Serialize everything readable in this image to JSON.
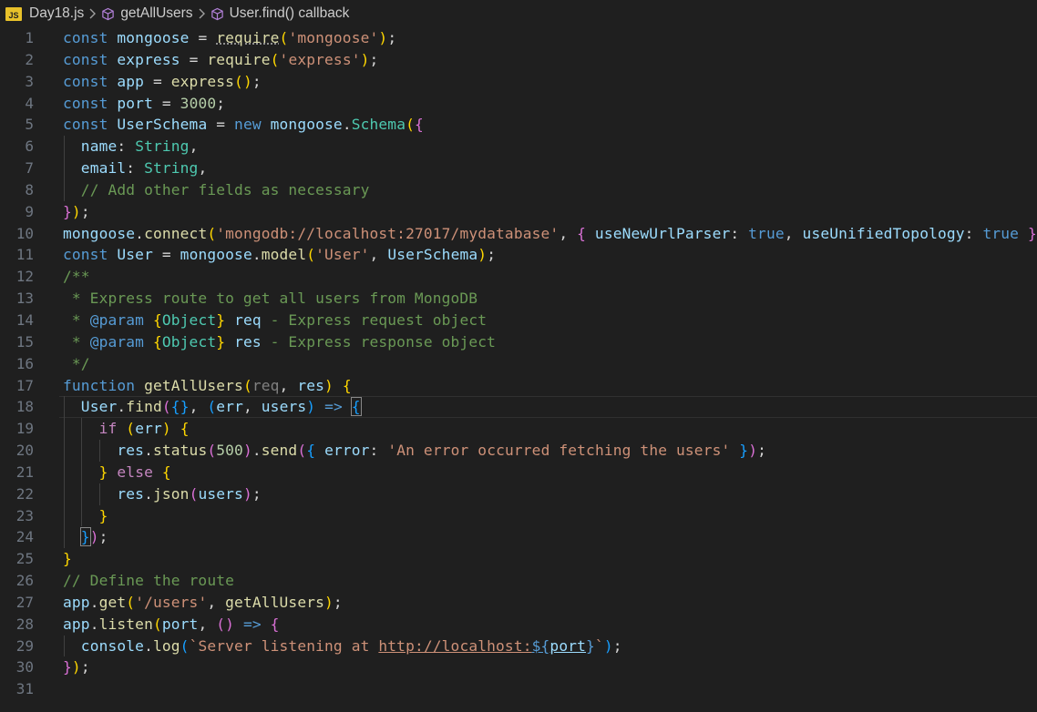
{
  "breadcrumb": {
    "file_icon": "JS",
    "file": "Day18.js",
    "symbol1": "getAllUsers",
    "symbol2": "User.find() callback"
  },
  "editor": {
    "language": "javascript",
    "current_line": 18,
    "lines": [
      {
        "n": "1",
        "t": [
          [
            "kw",
            "const"
          ],
          [
            "pln",
            " "
          ],
          [
            "var",
            "mongoose"
          ],
          [
            "pln",
            " = "
          ],
          [
            "fn dots",
            "require"
          ],
          [
            "b1",
            "("
          ],
          [
            "str",
            "'mongoose'"
          ],
          [
            "b1",
            ")"
          ],
          [
            "pln",
            ";"
          ]
        ]
      },
      {
        "n": "2",
        "t": [
          [
            "kw",
            "const"
          ],
          [
            "pln",
            " "
          ],
          [
            "var",
            "express"
          ],
          [
            "pln",
            " = "
          ],
          [
            "fn",
            "require"
          ],
          [
            "b1",
            "("
          ],
          [
            "str",
            "'express'"
          ],
          [
            "b1",
            ")"
          ],
          [
            "pln",
            ";"
          ]
        ]
      },
      {
        "n": "3",
        "t": [
          [
            "kw",
            "const"
          ],
          [
            "pln",
            " "
          ],
          [
            "var",
            "app"
          ],
          [
            "pln",
            " = "
          ],
          [
            "fn",
            "express"
          ],
          [
            "b1",
            "()"
          ],
          [
            "pln",
            ";"
          ]
        ]
      },
      {
        "n": "4",
        "t": [
          [
            "kw",
            "const"
          ],
          [
            "pln",
            " "
          ],
          [
            "var",
            "port"
          ],
          [
            "pln",
            " = "
          ],
          [
            "num",
            "3000"
          ],
          [
            "pln",
            ";"
          ]
        ]
      },
      {
        "n": "5",
        "t": [
          [
            "kw",
            "const"
          ],
          [
            "pln",
            " "
          ],
          [
            "var",
            "UserSchema"
          ],
          [
            "pln",
            " = "
          ],
          [
            "kw",
            "new"
          ],
          [
            "pln",
            " "
          ],
          [
            "var",
            "mongoose"
          ],
          [
            "pln",
            "."
          ],
          [
            "cls",
            "Schema"
          ],
          [
            "b1",
            "("
          ],
          [
            "b2",
            "{"
          ]
        ]
      },
      {
        "n": "6",
        "t": [
          [
            "pln",
            "  "
          ],
          [
            "var",
            "name"
          ],
          [
            "pln",
            ": "
          ],
          [
            "cls",
            "String"
          ],
          [
            "pln",
            ","
          ]
        ]
      },
      {
        "n": "7",
        "t": [
          [
            "pln",
            "  "
          ],
          [
            "var",
            "email"
          ],
          [
            "pln",
            ": "
          ],
          [
            "cls",
            "String"
          ],
          [
            "pln",
            ","
          ]
        ]
      },
      {
        "n": "8",
        "t": [
          [
            "pln",
            "  "
          ],
          [
            "com",
            "// Add other fields as necessary"
          ]
        ]
      },
      {
        "n": "9",
        "t": [
          [
            "b2",
            "}"
          ],
          [
            "b1",
            ")"
          ],
          [
            "pln",
            ";"
          ]
        ]
      },
      {
        "n": "10",
        "t": [
          [
            "var",
            "mongoose"
          ],
          [
            "pln",
            "."
          ],
          [
            "fn",
            "connect"
          ],
          [
            "b1",
            "("
          ],
          [
            "str",
            "'mongodb://localhost:27017/mydatabase'"
          ],
          [
            "pln",
            ", "
          ],
          [
            "b2",
            "{"
          ],
          [
            "pln",
            " "
          ],
          [
            "var",
            "useNewUrlParser"
          ],
          [
            "pln",
            ": "
          ],
          [
            "kw",
            "true"
          ],
          [
            "pln",
            ", "
          ],
          [
            "var",
            "useUnifiedTopology"
          ],
          [
            "pln",
            ": "
          ],
          [
            "kw",
            "true"
          ],
          [
            "pln",
            " "
          ],
          [
            "b2",
            "}"
          ],
          [
            "b1",
            ")"
          ],
          [
            "pln",
            ";"
          ]
        ]
      },
      {
        "n": "11",
        "t": [
          [
            "kw",
            "const"
          ],
          [
            "pln",
            " "
          ],
          [
            "var",
            "User"
          ],
          [
            "pln",
            " = "
          ],
          [
            "var",
            "mongoose"
          ],
          [
            "pln",
            "."
          ],
          [
            "fn",
            "model"
          ],
          [
            "b1",
            "("
          ],
          [
            "str",
            "'User'"
          ],
          [
            "pln",
            ", "
          ],
          [
            "var",
            "UserSchema"
          ],
          [
            "b1",
            ")"
          ],
          [
            "pln",
            ";"
          ]
        ]
      },
      {
        "n": "12",
        "t": [
          [
            "com",
            "/**"
          ]
        ]
      },
      {
        "n": "13",
        "t": [
          [
            "com",
            " * Express route to get all users from MongoDB"
          ]
        ]
      },
      {
        "n": "14",
        "t": [
          [
            "com",
            " * "
          ],
          [
            "kw",
            "@param"
          ],
          [
            "com",
            " "
          ],
          [
            "b1",
            "{"
          ],
          [
            "cls",
            "Object"
          ],
          [
            "b1",
            "}"
          ],
          [
            "com",
            " "
          ],
          [
            "var",
            "req"
          ],
          [
            "com",
            " - Express request object"
          ]
        ]
      },
      {
        "n": "15",
        "t": [
          [
            "com",
            " * "
          ],
          [
            "kw",
            "@param"
          ],
          [
            "com",
            " "
          ],
          [
            "b1",
            "{"
          ],
          [
            "cls",
            "Object"
          ],
          [
            "b1",
            "}"
          ],
          [
            "com",
            " "
          ],
          [
            "var",
            "res"
          ],
          [
            "com",
            " - Express response object"
          ]
        ]
      },
      {
        "n": "16",
        "t": [
          [
            "com",
            " */"
          ]
        ]
      },
      {
        "n": "17",
        "t": [
          [
            "kw",
            "function"
          ],
          [
            "pln",
            " "
          ],
          [
            "fn",
            "getAllUsers"
          ],
          [
            "b1",
            "("
          ],
          [
            "dim",
            "req"
          ],
          [
            "pln",
            ", "
          ],
          [
            "var",
            "res"
          ],
          [
            "b1",
            ")"
          ],
          [
            "pln",
            " "
          ],
          [
            "b1",
            "{"
          ]
        ]
      },
      {
        "n": "18",
        "t": [
          [
            "pln",
            "  "
          ],
          [
            "var",
            "User"
          ],
          [
            "pln",
            "."
          ],
          [
            "fn",
            "find"
          ],
          [
            "b2",
            "("
          ],
          [
            "b3",
            "{}"
          ],
          [
            "pln",
            ", "
          ],
          [
            "b3",
            "("
          ],
          [
            "var",
            "err"
          ],
          [
            "pln",
            ", "
          ],
          [
            "var",
            "users"
          ],
          [
            "b3",
            ")"
          ],
          [
            "pln",
            " "
          ],
          [
            "kw",
            "=>"
          ],
          [
            "pln",
            " "
          ],
          [
            "b3 bm",
            "{"
          ]
        ]
      },
      {
        "n": "19",
        "t": [
          [
            "pln",
            "    "
          ],
          [
            "ctl",
            "if"
          ],
          [
            "pln",
            " "
          ],
          [
            "b1",
            "("
          ],
          [
            "var",
            "err"
          ],
          [
            "b1",
            ")"
          ],
          [
            "pln",
            " "
          ],
          [
            "b1",
            "{"
          ]
        ]
      },
      {
        "n": "20",
        "t": [
          [
            "pln",
            "      "
          ],
          [
            "var",
            "res"
          ],
          [
            "pln",
            "."
          ],
          [
            "fn",
            "status"
          ],
          [
            "b2",
            "("
          ],
          [
            "num",
            "500"
          ],
          [
            "b2",
            ")"
          ],
          [
            "pln",
            "."
          ],
          [
            "fn",
            "send"
          ],
          [
            "b2",
            "("
          ],
          [
            "b3",
            "{"
          ],
          [
            "pln",
            " "
          ],
          [
            "var",
            "error"
          ],
          [
            "pln",
            ": "
          ],
          [
            "str",
            "'An error occurred fetching the users'"
          ],
          [
            "pln",
            " "
          ],
          [
            "b3",
            "}"
          ],
          [
            "b2",
            ")"
          ],
          [
            "pln",
            ";"
          ]
        ]
      },
      {
        "n": "21",
        "t": [
          [
            "pln",
            "    "
          ],
          [
            "b1",
            "}"
          ],
          [
            "pln",
            " "
          ],
          [
            "ctl",
            "else"
          ],
          [
            "pln",
            " "
          ],
          [
            "b1",
            "{"
          ]
        ]
      },
      {
        "n": "22",
        "t": [
          [
            "pln",
            "      "
          ],
          [
            "var",
            "res"
          ],
          [
            "pln",
            "."
          ],
          [
            "fn",
            "json"
          ],
          [
            "b2",
            "("
          ],
          [
            "var",
            "users"
          ],
          [
            "b2",
            ")"
          ],
          [
            "pln",
            ";"
          ]
        ]
      },
      {
        "n": "23",
        "t": [
          [
            "pln",
            "    "
          ],
          [
            "b1",
            "}"
          ]
        ]
      },
      {
        "n": "24",
        "t": [
          [
            "pln",
            "  "
          ],
          [
            "b3 bm",
            "}"
          ],
          [
            "b2",
            ")"
          ],
          [
            "pln",
            ";"
          ]
        ]
      },
      {
        "n": "25",
        "t": [
          [
            "b1",
            "}"
          ]
        ]
      },
      {
        "n": "26",
        "t": [
          [
            "com",
            "// Define the route"
          ]
        ]
      },
      {
        "n": "27",
        "t": [
          [
            "var",
            "app"
          ],
          [
            "pln",
            "."
          ],
          [
            "fn",
            "get"
          ],
          [
            "b1",
            "("
          ],
          [
            "str",
            "'/users'"
          ],
          [
            "pln",
            ", "
          ],
          [
            "fn",
            "getAllUsers"
          ],
          [
            "b1",
            ")"
          ],
          [
            "pln",
            ";"
          ]
        ]
      },
      {
        "n": "28",
        "t": [
          [
            "var",
            "app"
          ],
          [
            "pln",
            "."
          ],
          [
            "fn",
            "listen"
          ],
          [
            "b1",
            "("
          ],
          [
            "var",
            "port"
          ],
          [
            "pln",
            ", "
          ],
          [
            "b2",
            "()"
          ],
          [
            "pln",
            " "
          ],
          [
            "kw",
            "=>"
          ],
          [
            "pln",
            " "
          ],
          [
            "b2",
            "{"
          ]
        ]
      },
      {
        "n": "29",
        "t": [
          [
            "pln",
            "  "
          ],
          [
            "var",
            "console"
          ],
          [
            "pln",
            "."
          ],
          [
            "fn",
            "log"
          ],
          [
            "b3",
            "("
          ],
          [
            "str",
            "`Server listening at "
          ],
          [
            "str und",
            "http://localhost:"
          ],
          [
            "kw und",
            "${"
          ],
          [
            "var und",
            "port"
          ],
          [
            "kw",
            "}"
          ],
          [
            "str",
            "`"
          ],
          [
            "b3",
            ")"
          ],
          [
            "pln",
            ";"
          ]
        ]
      },
      {
        "n": "30",
        "t": [
          [
            "b2",
            "}"
          ],
          [
            "b1",
            ")"
          ],
          [
            "pln",
            ";"
          ]
        ]
      },
      {
        "n": "31",
        "t": []
      }
    ]
  }
}
